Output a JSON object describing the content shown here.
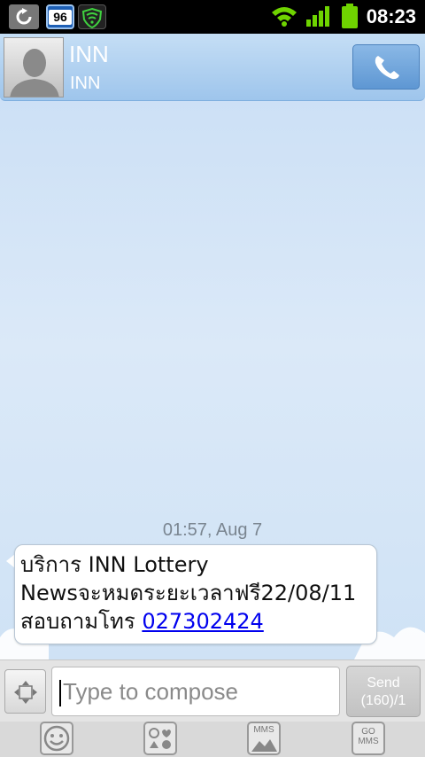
{
  "status_bar": {
    "time": "08:23",
    "notification_badge": "96",
    "icons": [
      "sync-icon",
      "badge-96-icon",
      "shield-icon",
      "wifi-icon",
      "signal-icon",
      "battery-icon"
    ]
  },
  "contact": {
    "name": "INN",
    "number": "INN"
  },
  "conversation": {
    "messages": [
      {
        "timestamp": "01:57, Aug 7",
        "line1": "บริการ INN Lottery",
        "line2": "Newsจะหมดระยะเวลาฟรี22/08/11",
        "line3_prefix": " สอบถามโทร ",
        "link": "027302424"
      }
    ]
  },
  "compose": {
    "placeholder": "Type to compose",
    "send_label": "Send",
    "send_count": "(160)/1"
  },
  "toolbar": {
    "mms_label": "MMS",
    "gomms_label_top": "GO",
    "gomms_label_bottom": "MMS"
  },
  "colors": {
    "header_blue": "#9ec5ec",
    "link_blue": "#0000ee",
    "background": "#dbe9f8"
  }
}
